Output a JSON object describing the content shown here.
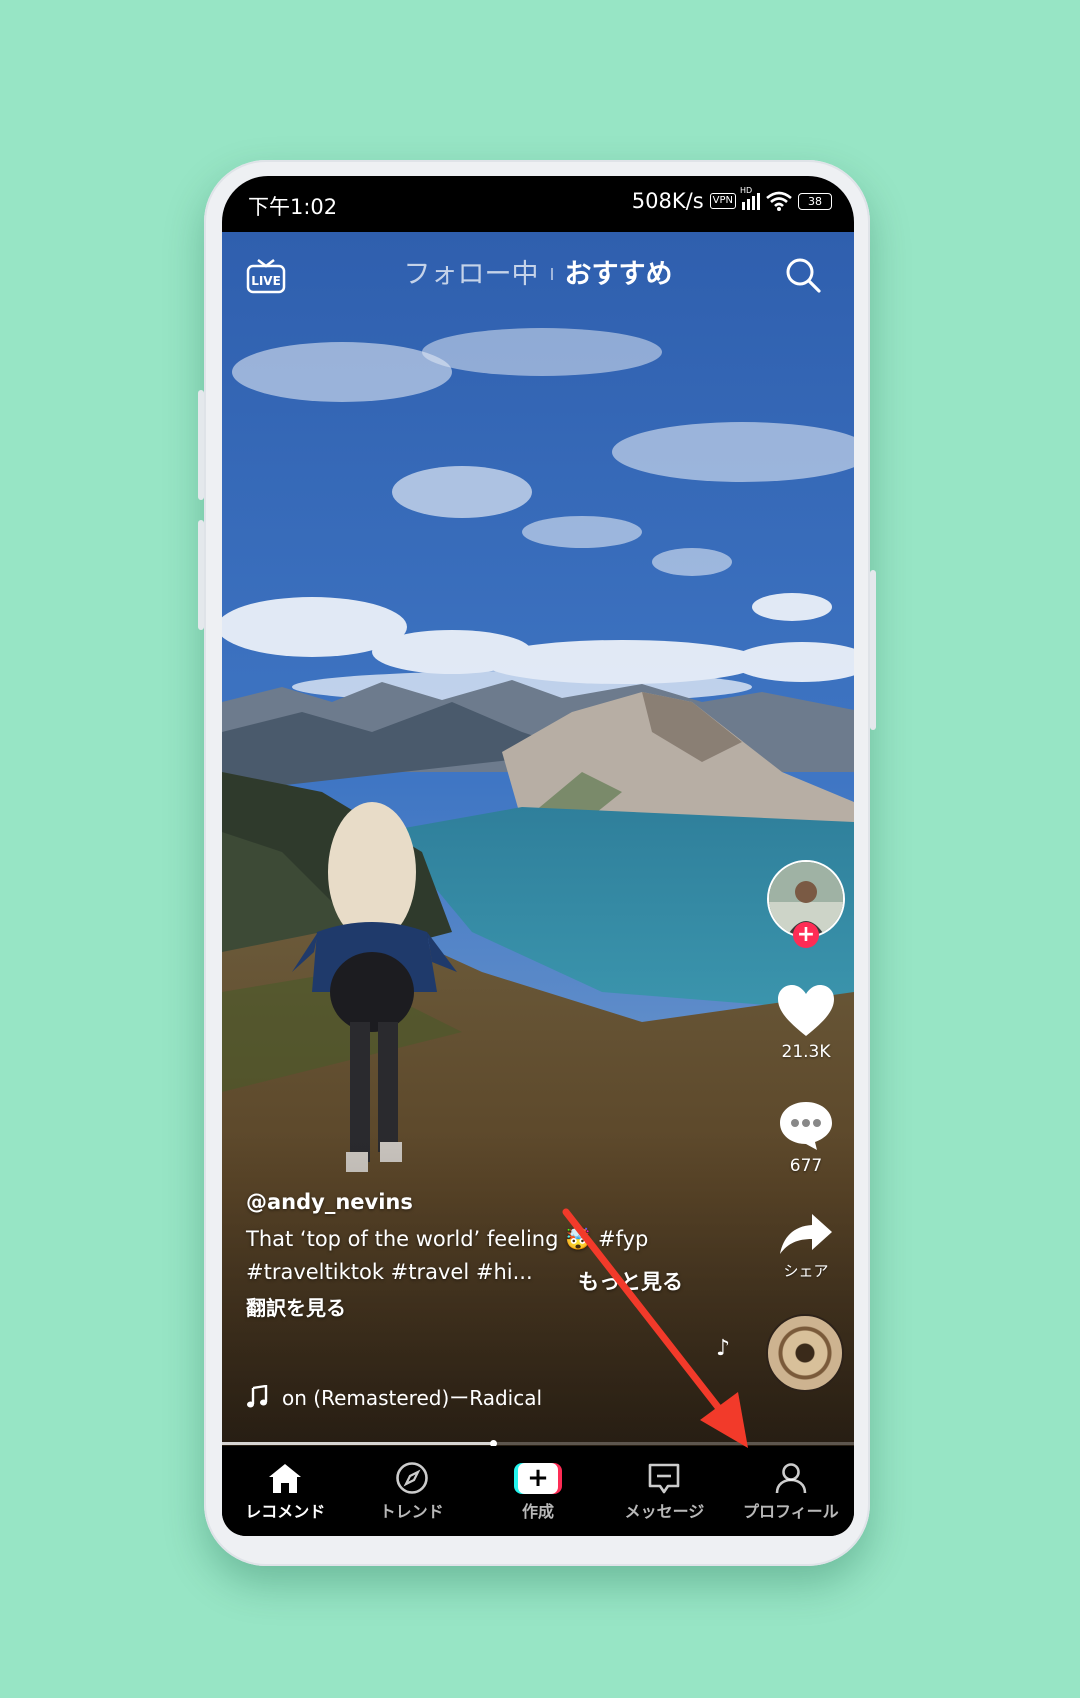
{
  "status_bar": {
    "time": "下午1:02",
    "network_speed": "508K/s",
    "vpn_label": "VPN",
    "hd_label": "HD",
    "battery": "38"
  },
  "top_bar": {
    "live_icon_label": "LIVE",
    "tabs": [
      {
        "label": "フォロー中",
        "active": false
      },
      {
        "label": "おすすめ",
        "active": true
      }
    ],
    "search_icon": "search-icon"
  },
  "side_rail": {
    "likes": "21.3K",
    "comments": "677",
    "share_label": "シェア"
  },
  "caption": {
    "author": "@andy_nevins",
    "line1": "That ‘top of the world’ feeling 🤯 #fyp",
    "line2": "#traveltiktok #travel #hi...",
    "more_label": "もっと見る",
    "translate_label": "翻訳を見る"
  },
  "music": {
    "track": "on (Remastered)ーRadical"
  },
  "progress": {
    "fraction": 0.43
  },
  "navbar": {
    "items": [
      {
        "label": "レコメンド",
        "icon": "home-icon",
        "active": true
      },
      {
        "label": "トレンド",
        "icon": "compass-icon",
        "active": false
      },
      {
        "label": "作成",
        "icon": "create-icon",
        "active": false
      },
      {
        "label": "メッセージ",
        "icon": "message-icon",
        "active": false
      },
      {
        "label": "プロフィール",
        "icon": "profile-icon",
        "active": false
      }
    ]
  },
  "colors": {
    "background": "#97e5c5",
    "tiktok_red": "#fe2c55",
    "tiktok_cyan": "#25f4ee",
    "annotation_arrow": "#f23a2a"
  }
}
